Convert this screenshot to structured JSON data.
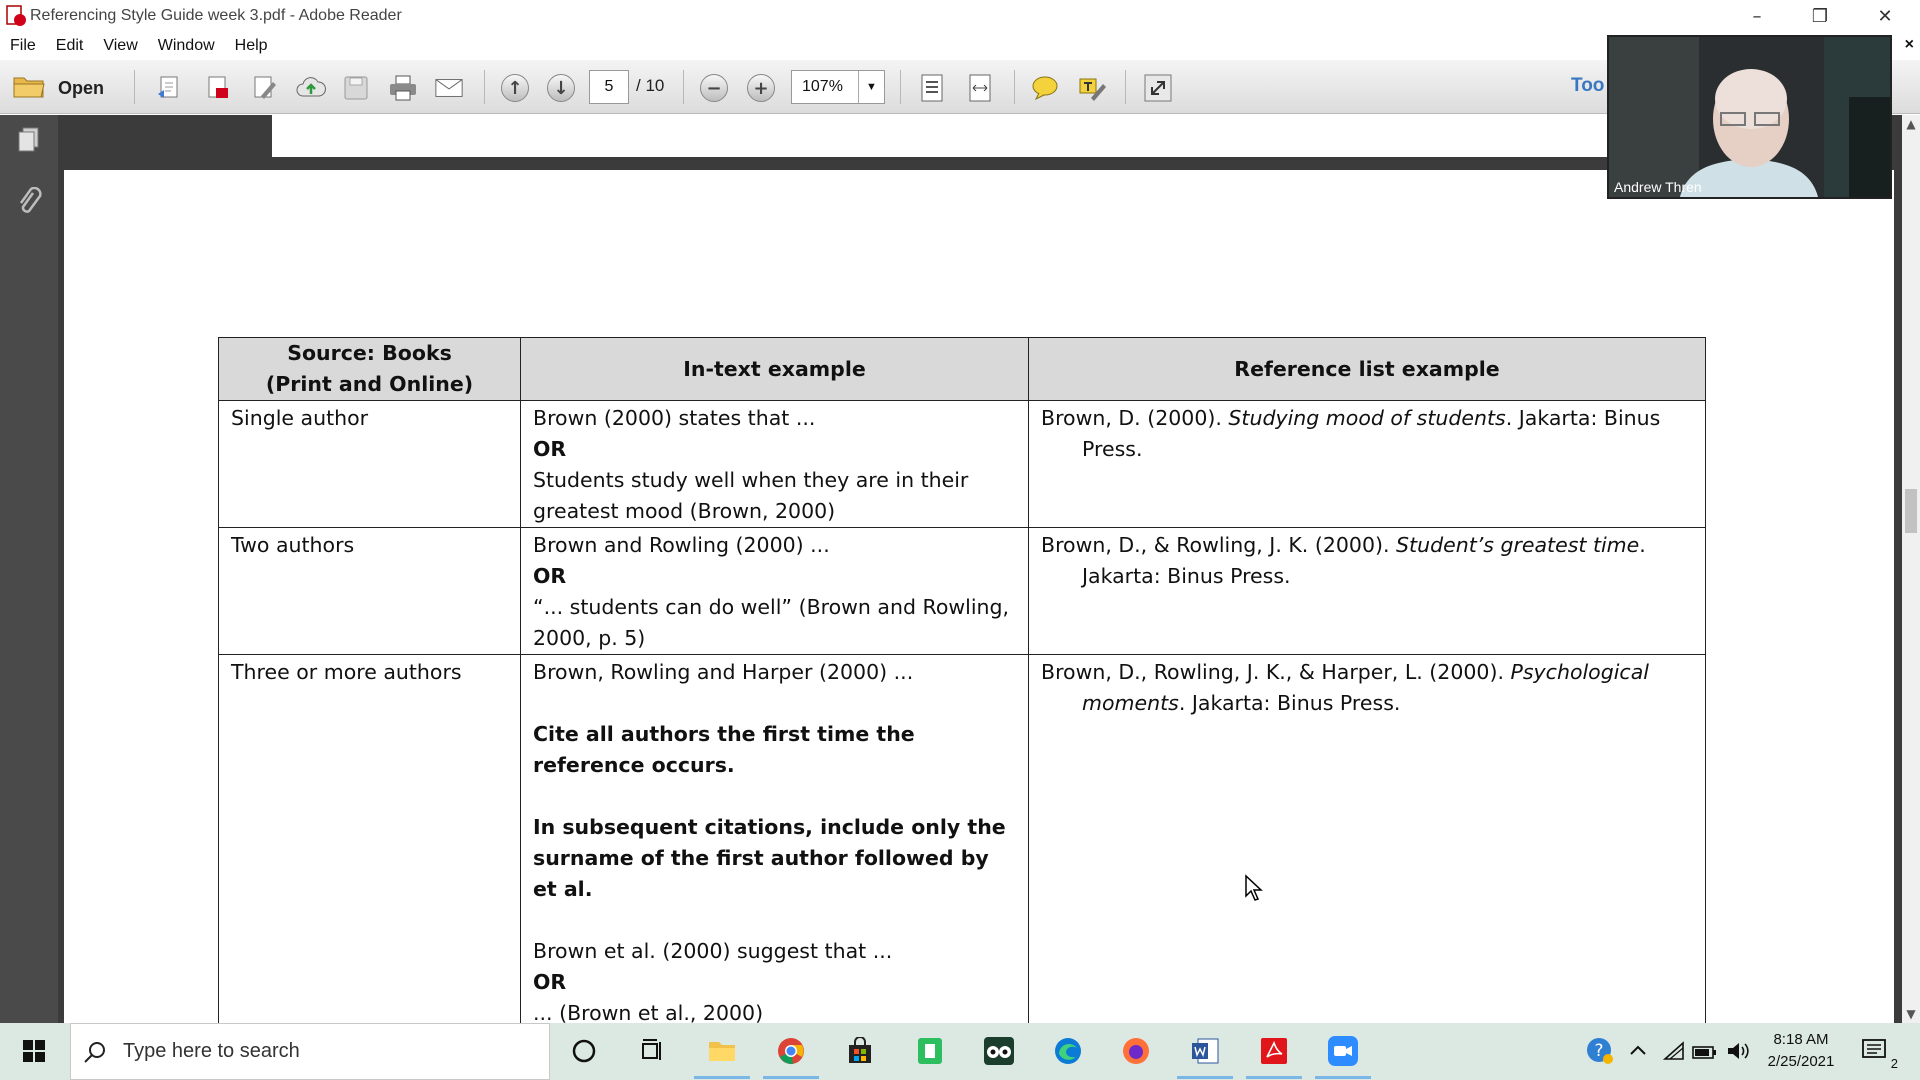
{
  "window": {
    "title": "Referencing Style Guide week 3.pdf - Adobe Reader",
    "minimize_icon": "minimize-icon",
    "restore_icon": "restore-icon",
    "close_icon": "close-icon"
  },
  "menu": {
    "items": [
      "File",
      "Edit",
      "View",
      "Window",
      "Help"
    ],
    "close_glyph": "×"
  },
  "toolbar": {
    "open_label": "Open",
    "current_page": "5",
    "page_total": "/ 10",
    "zoom": "107%",
    "tools_label": "Too"
  },
  "video": {
    "participant_name": "Andrew Thren"
  },
  "table": {
    "headers": {
      "col1_line1": "Source: Books",
      "col1_line2": "(Print and Online)",
      "col2": "In-text example",
      "col3": "Reference list example"
    },
    "rows": [
      {
        "source": "Single author",
        "intext": [
          "Brown (2000) states that ...",
          "OR",
          "Students study well when they are in their greatest mood (Brown, 2000)"
        ],
        "ref_pre": "Brown, D. (2000). ",
        "ref_italic": "Studying mood of students",
        "ref_post": ". Jakarta: Binus Press."
      },
      {
        "source": "Two authors",
        "intext": [
          "Brown and Rowling (2000) ...",
          "OR",
          "“... students can do well” (Brown and Rowling, 2000, p. 5)"
        ],
        "ref_pre": "Brown, D., & Rowling, J. K. (2000). ",
        "ref_italic": "Student’s greatest time",
        "ref_post": ". Jakarta: Binus Press."
      },
      {
        "source": "Three or more authors",
        "intext": [
          "Brown, Rowling and Harper (2000) ...",
          "Cite all authors the first time the reference occurs.",
          "In subsequent citations, include only the surname of the first author followed by et al.",
          "Brown et al. (2000) suggest that ...",
          "OR",
          "... (Brown et al., 2000)"
        ],
        "ref_pre": "Brown, D., Rowling, J. K., & Harper, L. (2000). ",
        "ref_italic": "Psychological moments",
        "ref_post": ". Jakarta: Binus Press."
      }
    ]
  },
  "taskbar": {
    "search_placeholder": "Type here to search",
    "time": "8:18 AM",
    "date": "2/25/2021",
    "notification_count": "2"
  }
}
